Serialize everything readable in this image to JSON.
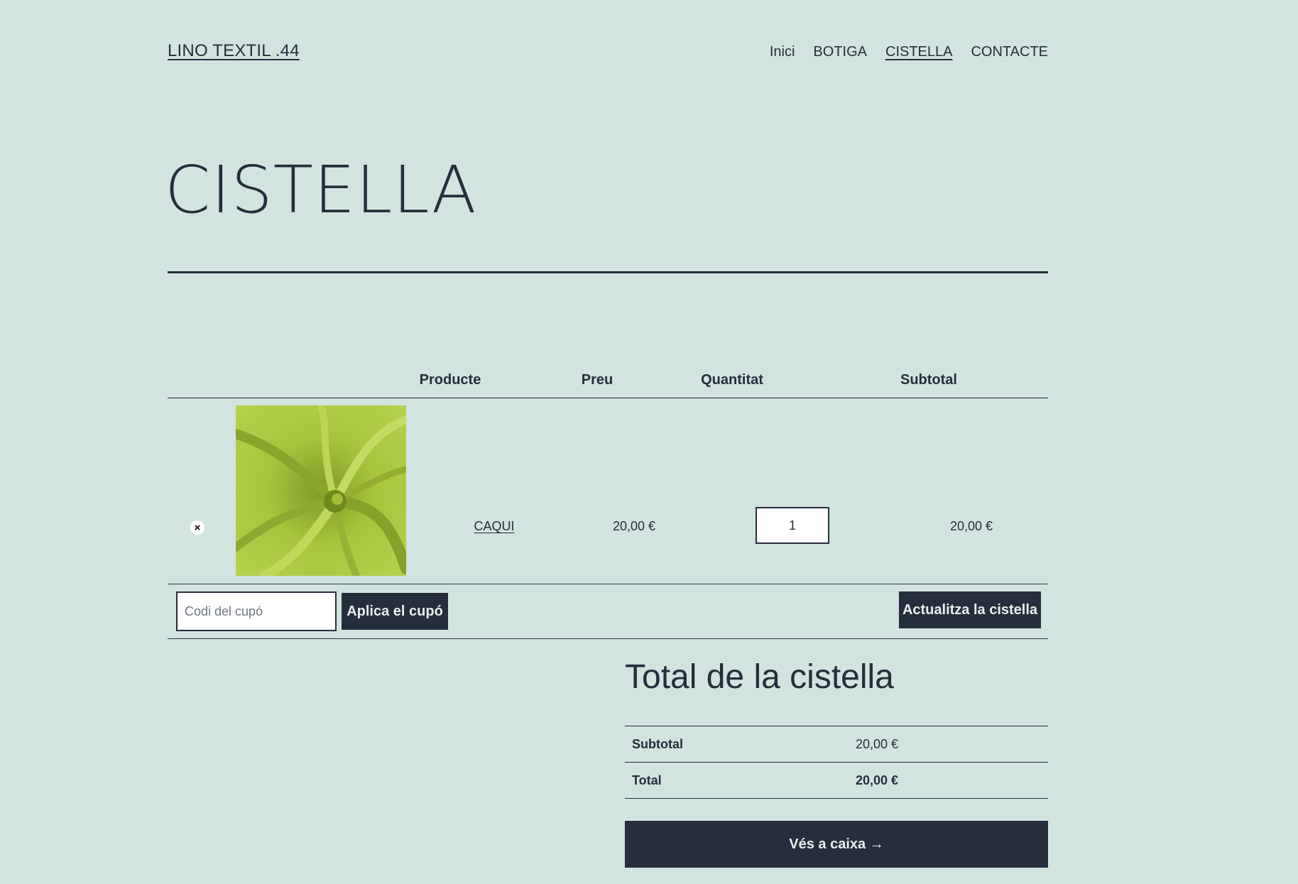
{
  "site": {
    "title": "LINO TEXTIL .44"
  },
  "nav": [
    "Inici",
    "BOTIGA",
    "CISTELLA",
    "CONTACTE"
  ],
  "page": {
    "title": "CISTELLA"
  },
  "cart": {
    "headers": {
      "product": "Producte",
      "price": "Preu",
      "quantity": "Quantitat",
      "subtotal": "Subtotal"
    },
    "items": [
      {
        "remove": "×",
        "name": "CAQUI",
        "price": "20,00 €",
        "quantity": "1",
        "subtotal": "20,00 €"
      }
    ],
    "coupon_placeholder": "Codi del cupó",
    "apply_coupon": "Aplica el cupó",
    "update_cart": "Actualitza la cistella"
  },
  "totals": {
    "title": "Total de la cistella",
    "subtotal_label": "Subtotal",
    "subtotal_value": "20,00 €",
    "total_label": "Total",
    "total_value": "20,00 €",
    "checkout": "Vés a caixa →"
  },
  "colors": {
    "background": "#d2e4df",
    "text": "#252e3c",
    "button": "#252e3c",
    "product_green": "#a8c640"
  }
}
